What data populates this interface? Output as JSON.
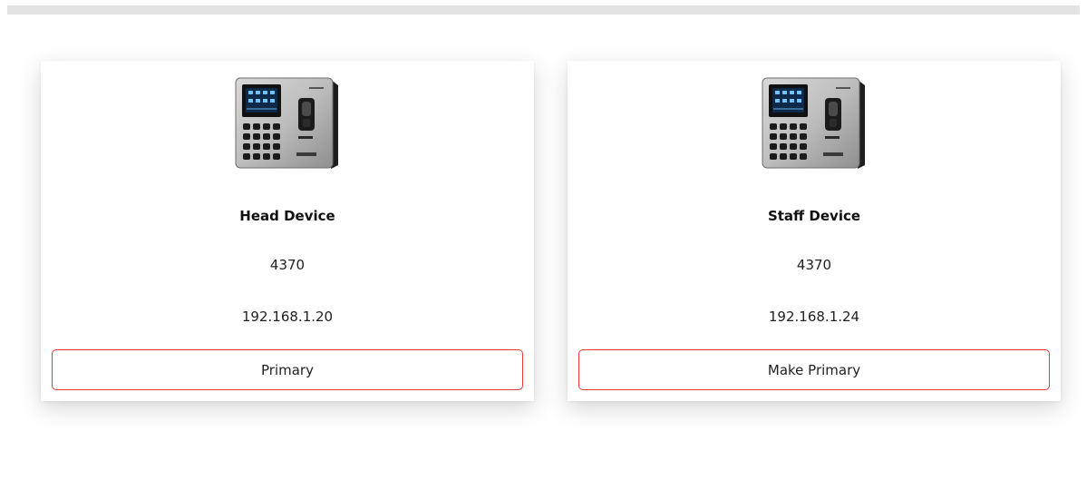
{
  "devices": [
    {
      "name": "Head Device",
      "model": "4370",
      "ip": "192.168.1.20",
      "button_label": "Primary"
    },
    {
      "name": "Staff Device",
      "model": "4370",
      "ip": "192.168.1.24",
      "button_label": "Make Primary"
    }
  ],
  "colors": {
    "button_border": "#e53935",
    "top_bar": "#e3e3e3"
  },
  "icons": {
    "device_image": "fingerprint-terminal-icon"
  }
}
